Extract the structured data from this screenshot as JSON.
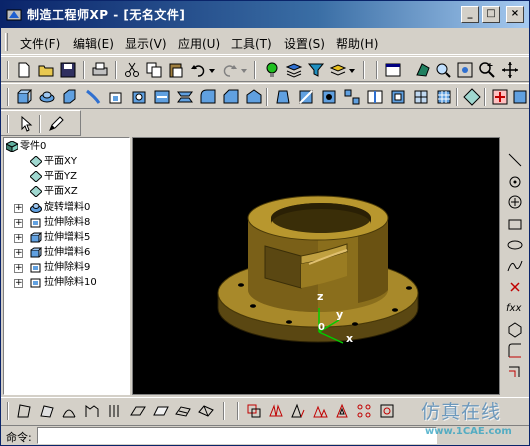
{
  "window": {
    "title": "制造工程师XP - [无名文件]",
    "minimize_glyph": "_",
    "maximize_glyph": "□",
    "close_glyph": "×"
  },
  "menu": {
    "items": [
      "文件(F)",
      "编辑(E)",
      "显示(V)",
      "应用(U)",
      "工具(T)",
      "设置(S)",
      "帮助(H)"
    ]
  },
  "tree": {
    "root": "零件0",
    "items": [
      {
        "label": "平面XY",
        "icon": "plane-icon"
      },
      {
        "label": "平面YZ",
        "icon": "plane-icon"
      },
      {
        "label": "平面XZ",
        "icon": "plane-icon"
      },
      {
        "label": "旋转增料0",
        "icon": "revolve-feature-icon"
      },
      {
        "label": "拉伸除料8",
        "icon": "extrude-cut-icon"
      },
      {
        "label": "拉伸增料5",
        "icon": "extrude-add-icon"
      },
      {
        "label": "拉伸增料6",
        "icon": "extrude-add-icon"
      },
      {
        "label": "拉伸除料9",
        "icon": "extrude-cut-icon"
      },
      {
        "label": "拉伸除料10",
        "icon": "extrude-cut-icon"
      }
    ]
  },
  "viewport": {
    "axis_z": "z",
    "axis_y": "y",
    "axis_x": "x",
    "origin": "0",
    "model_color": "#a8892a",
    "axis_color": "#00cc00"
  },
  "right_toolbar": {
    "fxx_label": "fxx"
  },
  "command": {
    "label": "命令:",
    "value": ""
  },
  "watermark": {
    "line1": "仿真在线",
    "line2": "www.1CAE.com"
  },
  "colors": {
    "titlebar_start": "#0a246a",
    "titlebar_end": "#a6caf0",
    "face": "#d4d0c8"
  }
}
